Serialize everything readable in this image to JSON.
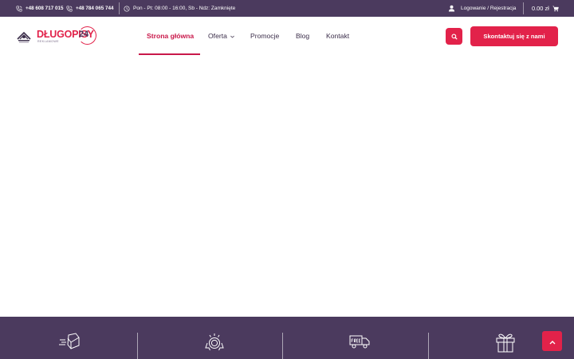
{
  "topbar": {
    "phone1": "+48 608 717 015",
    "phone2": "+48 784 065 744",
    "hours": "Pon - Pt: 08:00 - 16:00, Sb - Ndz: Zamknięte",
    "account_link": "Logowanie / Rejestracja",
    "cart_total": "0.00 zł"
  },
  "logo": {
    "brand": "DŁUGOPISY",
    "number": "24",
    "tagline": "REKLAMOWE"
  },
  "nav": {
    "home": "Strona główna",
    "offer": "Oferta",
    "promotions": "Promocje",
    "blog": "Blog",
    "contact": "Kontakt"
  },
  "header": {
    "contact_button": "Skontaktuj się z nami"
  },
  "features": {
    "icons": [
      "delivery-box-icon",
      "award-badge-icon",
      "free-shipping-truck-icon",
      "gift-icon"
    ]
  },
  "colors": {
    "brand_purple": "#4b3a5e",
    "accent_red": "#e2224a",
    "active_nav": "#c9184a"
  }
}
